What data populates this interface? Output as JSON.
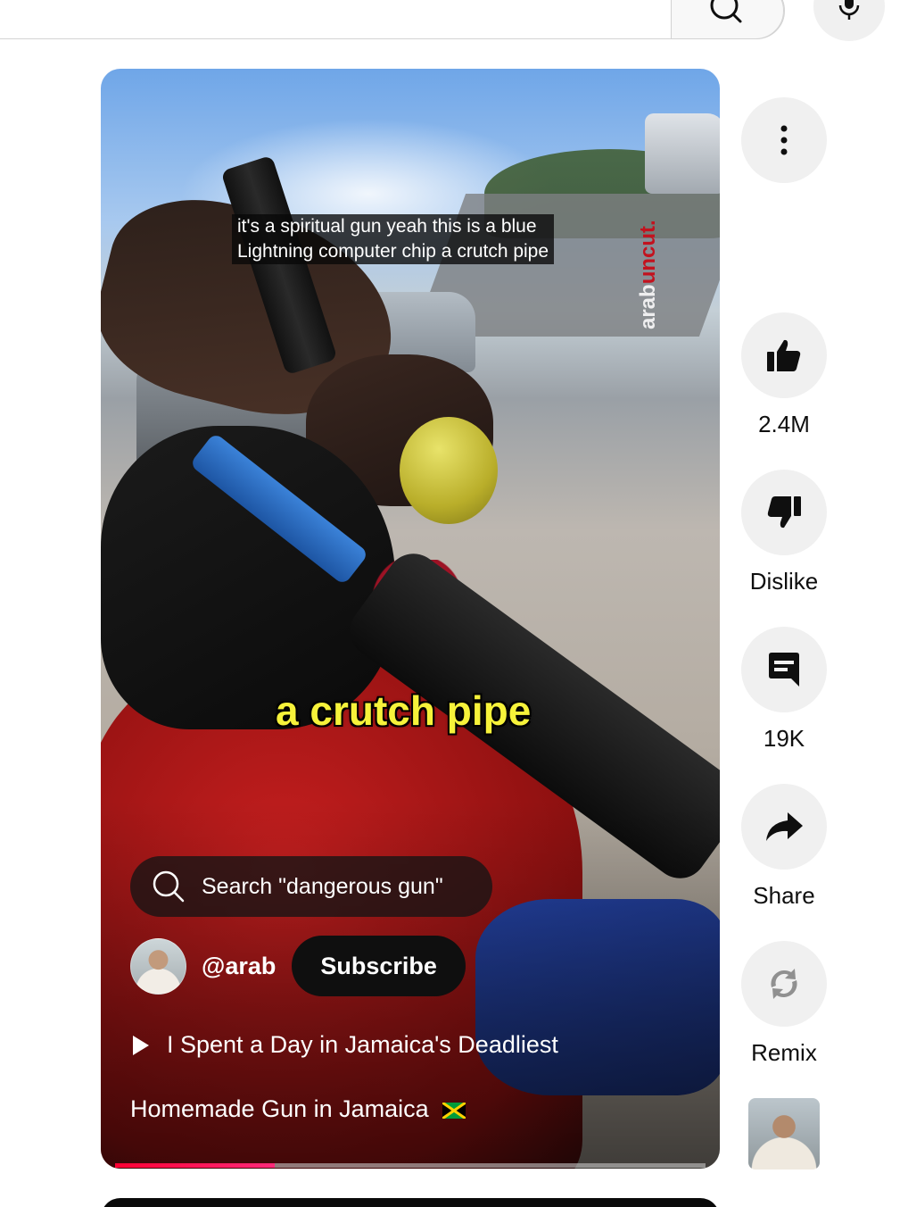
{
  "search": {
    "icon": "search-icon"
  },
  "mic": {
    "icon": "mic-icon"
  },
  "video": {
    "caption_lines": [
      "it's a spiritual gun yeah this is a blue",
      "Lightning computer chip a crutch pipe"
    ],
    "watermark": {
      "part1": "arab",
      "part2": "uncut."
    },
    "overlay_text": "a crutch pipe",
    "search_chip": "Search \"dangerous gun\"",
    "channel_handle": "@arab",
    "subscribe_label": "Subscribe",
    "title": "I Spent a Day in Jamaica's Deadliest",
    "description": "Homemade Gun in Jamaica",
    "progress": 0.27
  },
  "actions": {
    "more": {
      "icon": "more-vert-icon"
    },
    "like": {
      "icon": "thumb-up-icon",
      "label": "2.4M"
    },
    "dislike": {
      "icon": "thumb-down-icon",
      "label": "Dislike"
    },
    "comments": {
      "icon": "comment-icon",
      "label": "19K"
    },
    "share": {
      "icon": "share-icon",
      "label": "Share"
    },
    "remix": {
      "icon": "remix-icon",
      "label": "Remix"
    }
  },
  "colors": {
    "accent": "#ff0033",
    "overlay_text": "#f6f23a",
    "watermark_red": "#c3121e"
  }
}
